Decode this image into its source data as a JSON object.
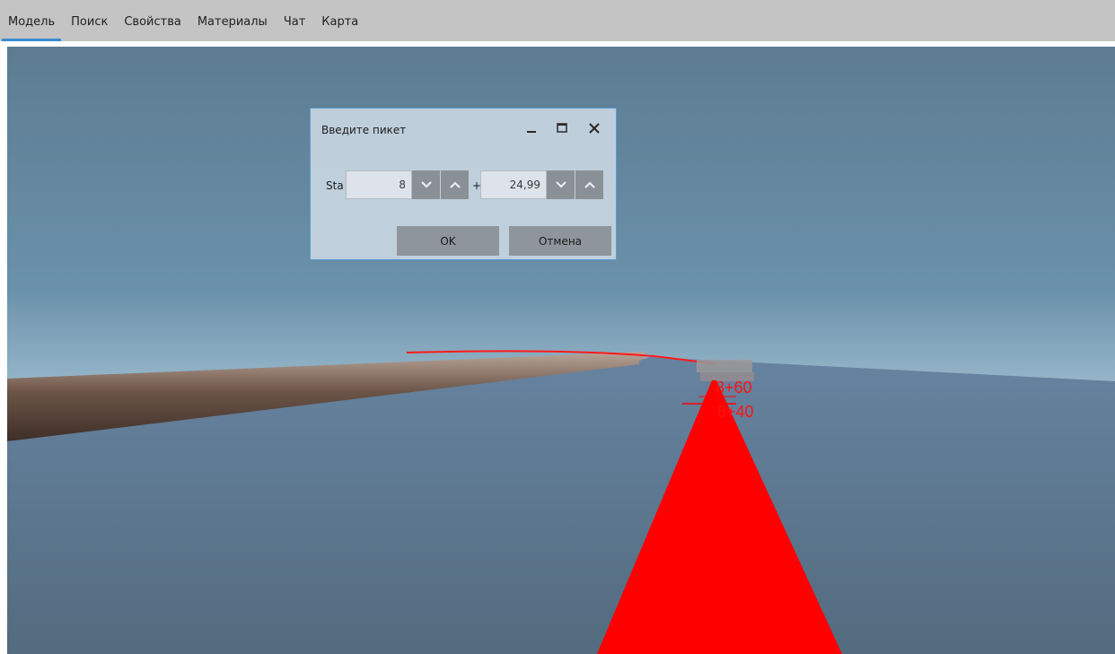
{
  "menu": {
    "items": [
      {
        "label": "Модель",
        "active": true
      },
      {
        "label": "Поиск"
      },
      {
        "label": "Свойства"
      },
      {
        "label": "Материалы"
      },
      {
        "label": "Чат"
      },
      {
        "label": "Карта"
      }
    ]
  },
  "dialog": {
    "title": "Введите пикет",
    "controls": [
      "minimize-icon",
      "maximize-icon",
      "close-icon"
    ],
    "sta_label": "Sta",
    "station": "8",
    "separator": "+",
    "offset": "24,99",
    "ok_label": "OK",
    "cancel_label": "Отмена"
  },
  "viewport": {
    "station_labels": [
      "8+60",
      "8+40"
    ],
    "colors": {
      "road": "#ff0000",
      "ground": "#587184",
      "sky_top": "#5d7c91",
      "terrain_edge": "#4c3b33",
      "accent": "#3b8bd4"
    }
  }
}
